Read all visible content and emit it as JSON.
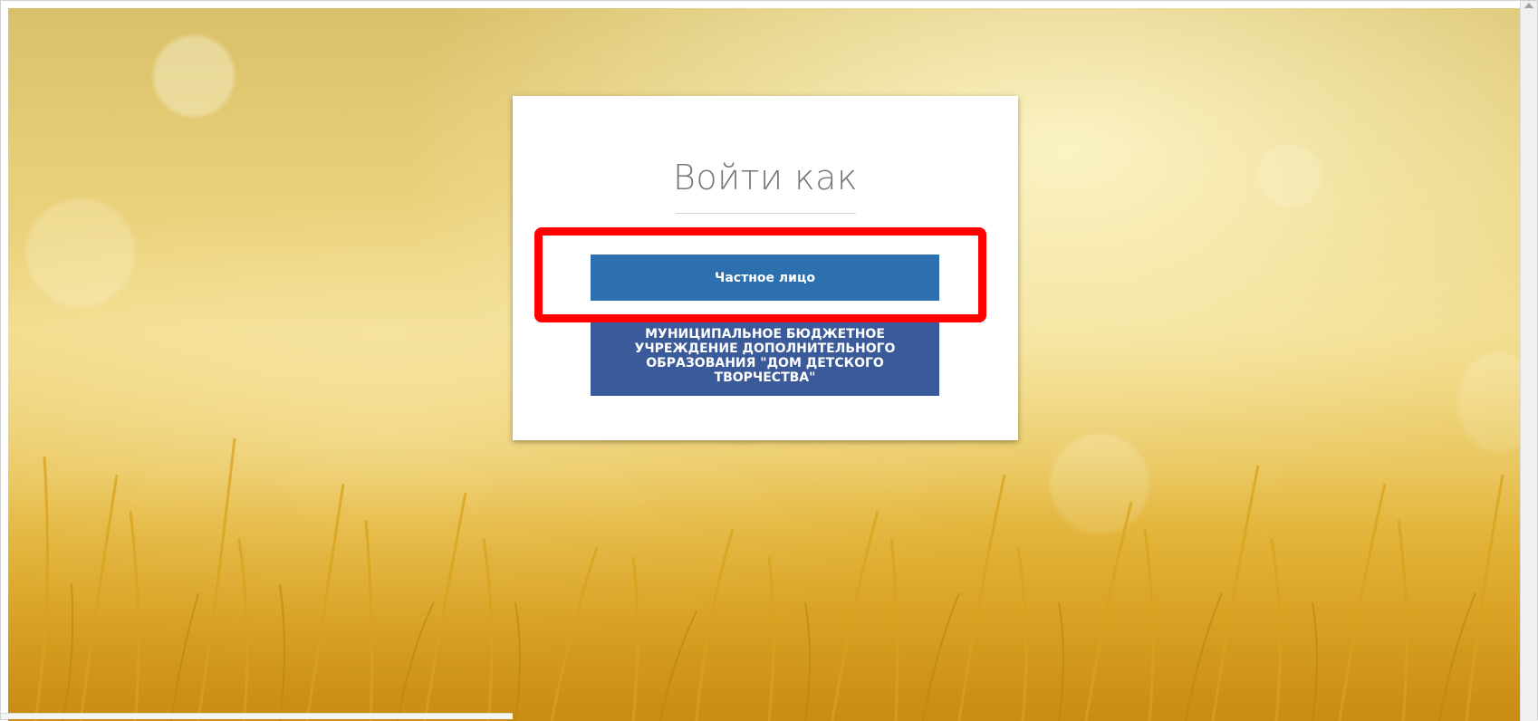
{
  "login": {
    "title": "Войти как",
    "options": {
      "private_person": "Частное лицо",
      "organization": "МУНИЦИПАЛЬНОЕ БЮДЖЕТНОЕ УЧРЕЖДЕНИЕ ДОПОЛНИТЕЛЬНОГО ОБРАЗОВАНИЯ \"ДОМ ДЕТСКОГО ТВОРЧЕСТВА\""
    }
  },
  "colors": {
    "private_button": "#2d70b0",
    "organization_button": "#3b5a99",
    "highlight": "#ff0000",
    "background": "#e8cf78"
  },
  "icons": {
    "scroll_up": "triangle-up"
  }
}
